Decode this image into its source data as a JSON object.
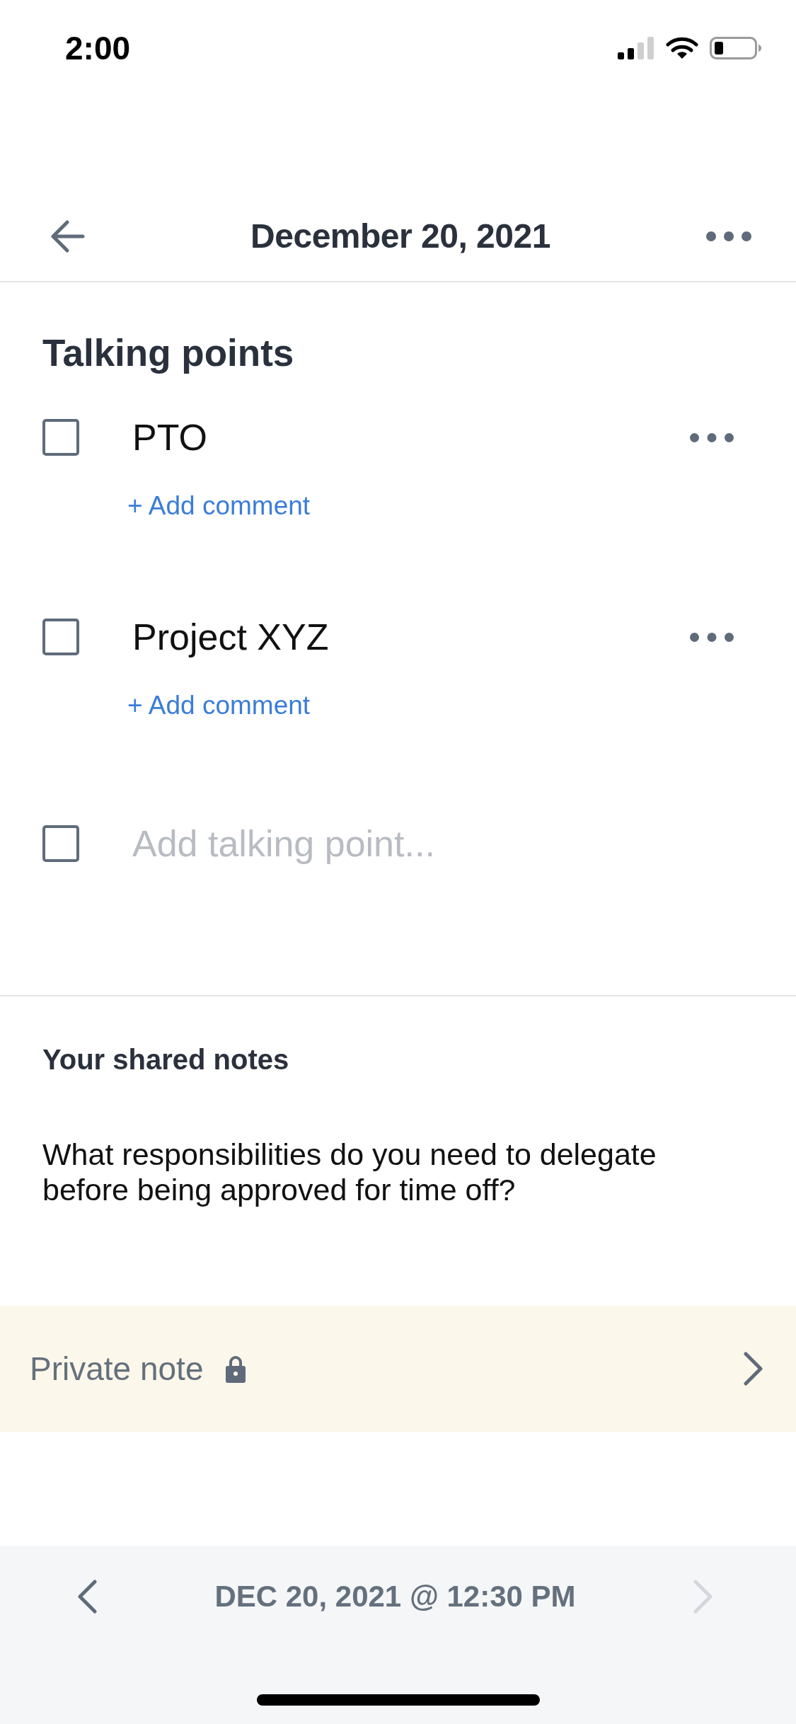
{
  "status_bar": {
    "time": "2:00"
  },
  "header": {
    "title": "December 20, 2021"
  },
  "talking_points": {
    "heading": "Talking points",
    "items": [
      {
        "text": "PTO",
        "checked": false,
        "comment_link": "+ Add comment"
      },
      {
        "text": "Project XYZ",
        "checked": false,
        "comment_link": "+ Add comment"
      }
    ],
    "new_item": {
      "placeholder": "Add talking point...",
      "checked": false
    }
  },
  "shared_notes": {
    "heading": "Your shared notes",
    "text": "What responsibilities do you need to delegate before being approved for time off?"
  },
  "private_note": {
    "label": "Private note"
  },
  "footer": {
    "previous": {
      "disabled": false
    },
    "date": "DEC 20, 2021 @ 12:30 PM",
    "next": {
      "disabled": true
    }
  }
}
